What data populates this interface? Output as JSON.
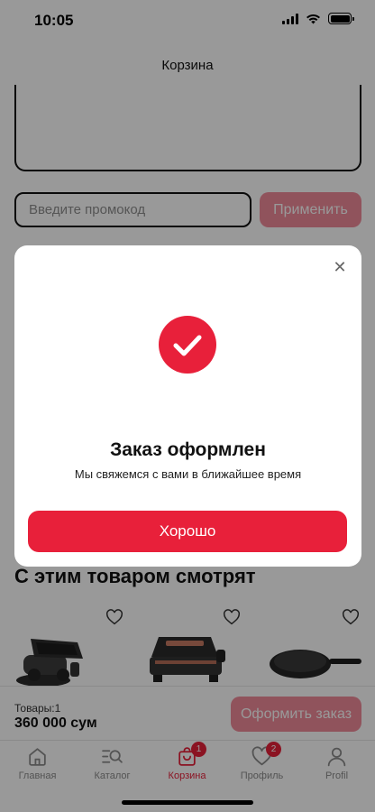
{
  "status_bar": {
    "time": "10:05"
  },
  "header": {
    "title": "Корзина"
  },
  "promo": {
    "placeholder": "Введите промокод",
    "apply_label": "Применить"
  },
  "recommendations": {
    "title": "С этим товаром смотрят",
    "products": [
      {
        "image": "contact-grill-icon"
      },
      {
        "image": "panini-grill-icon"
      },
      {
        "image": "frying-pan-icon"
      }
    ]
  },
  "checkout": {
    "items_label": "Товары:1",
    "total": "360 000 сум",
    "button_label": "Оформить заказ"
  },
  "tabs": [
    {
      "label": "Главная",
      "icon": "home-icon",
      "active": false,
      "badge": null
    },
    {
      "label": "Каталог",
      "icon": "catalog-search-icon",
      "active": false,
      "badge": null
    },
    {
      "label": "Корзина",
      "icon": "cart-bag-icon",
      "active": true,
      "badge": "1"
    },
    {
      "label": "Профиль",
      "icon": "heart-icon",
      "active": false,
      "badge": "2"
    },
    {
      "label": "Profil",
      "icon": "user-icon",
      "active": false,
      "badge": null
    }
  ],
  "modal": {
    "title": "Заказ оформлен",
    "message": "Мы свяжемся с вами в ближайшее время",
    "ok_label": "Хорошо",
    "close_icon": "close-icon",
    "status_icon": "check-circle-icon"
  },
  "colors": {
    "accent": "#e8203a",
    "accent_disabled": "#f08a99",
    "overlay": "#000000"
  }
}
